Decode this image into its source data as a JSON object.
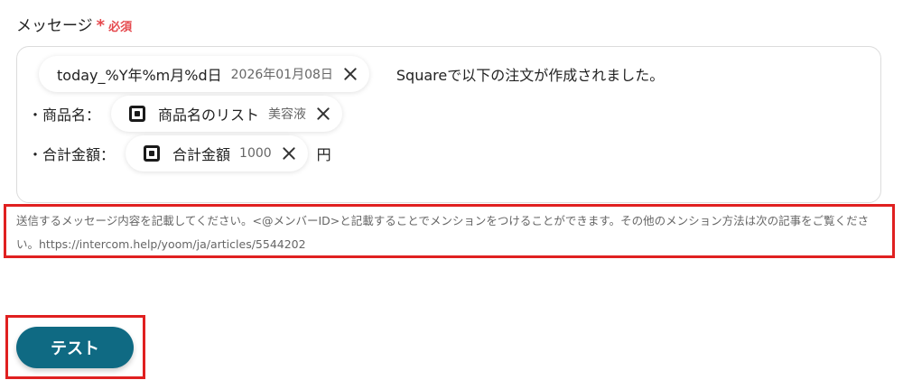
{
  "field": {
    "label": "メッセージ",
    "required_mark": "*",
    "required_text": "必須"
  },
  "editor": {
    "line1": {
      "chip": {
        "name": "today_%Y年%m月%d日",
        "value": "2026年01月08日"
      },
      "trailing_text": "Squareで以下の注文が作成されました。"
    },
    "line2": {
      "prefix": "・商品名：",
      "chip": {
        "icon": "square-logo-icon",
        "name": "商品名のリスト",
        "value": "美容液"
      }
    },
    "line3": {
      "prefix": "・合計金額：",
      "chip": {
        "icon": "square-logo-icon",
        "name": "合計金額",
        "value": "1000"
      },
      "suffix": "円"
    }
  },
  "help_text": "送信するメッセージ内容を記載してください。<@メンバーID>と記載することでメンションをつけることができます。その他のメンション方法は次の記事をご覧ください。https://intercom.help/yoom/ja/articles/5544202",
  "buttons": {
    "test_label": "テスト"
  },
  "colors": {
    "required": "#e5484d",
    "highlight_border": "#e02020",
    "primary_button": "#0f6a83"
  }
}
